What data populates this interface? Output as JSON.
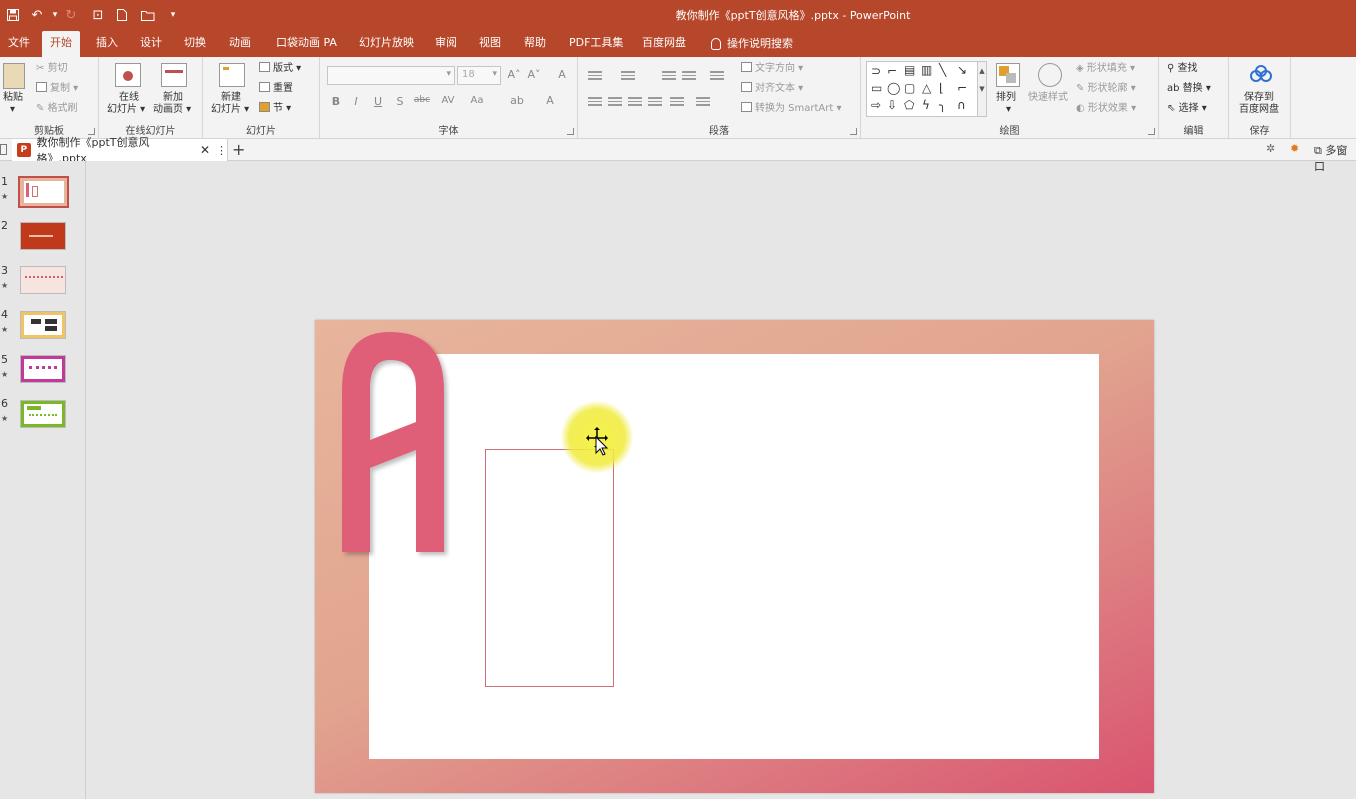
{
  "window": {
    "title": "教你制作《pptT创意风格》.pptx  -  PowerPoint",
    "accent": "#b7472a"
  },
  "quick_access": [
    {
      "name": "save-icon",
      "glyph": "💾"
    },
    {
      "name": "undo-icon",
      "glyph": "↶"
    },
    {
      "name": "redo-icon",
      "glyph": "↻"
    },
    {
      "name": "start-from-beginning-icon",
      "glyph": "⊡"
    },
    {
      "name": "new-file-icon",
      "glyph": "🗋"
    },
    {
      "name": "open-folder-icon",
      "glyph": "📂"
    },
    {
      "name": "customize-qat-icon",
      "glyph": "▾"
    }
  ],
  "tabs": [
    "文件",
    "开始",
    "插入",
    "设计",
    "切换",
    "动画",
    "口袋动画 PA",
    "幻灯片放映",
    "审阅",
    "视图",
    "帮助",
    "PDF工具集",
    "百度网盘"
  ],
  "tell_me": "操作说明搜索",
  "ribbon": {
    "clipboard": {
      "paste": "粘贴",
      "cut": "剪切",
      "copy": "复制",
      "format_painter": "格式刷",
      "label": "剪贴板"
    },
    "online_slides": {
      "online": "在线",
      "online2": "幻灯片 ▾",
      "new_anim": "新加",
      "new_anim2": "动画页 ▾",
      "label": "在线幻灯片"
    },
    "slides": {
      "new": "新建",
      "new2": "幻灯片 ▾",
      "layout": "版式 ▾",
      "reset": "重置",
      "section": "节 ▾",
      "label": "幻灯片"
    },
    "font": {
      "size": "18",
      "label": "字体",
      "bold": "B",
      "italic": "I",
      "underline": "U",
      "shadow": "S",
      "strike": "abc",
      "spacing": "AV",
      "case": "Aa",
      "grow": "A˄",
      "shrink": "A˅",
      "clear": "A",
      "color": "A"
    },
    "paragraph": {
      "direction": "文字方向 ▾",
      "align": "对齐文本 ▾",
      "smartart": "转换为 SmartArt ▾",
      "label": "段落"
    },
    "drawing": {
      "arrange": "排列",
      "quick_styles": "快速样式",
      "fill": "形状填充 ▾",
      "outline": "形状轮廓 ▾",
      "effects": "形状效果 ▾",
      "label": "绘图"
    },
    "editing": {
      "find": "查找",
      "replace": "替换",
      "select": "选择 ▾",
      "label": "编辑"
    },
    "save": {
      "save1": "保存到",
      "save2": "百度网盘",
      "label": "保存"
    }
  },
  "doc_tab": {
    "name": "教你制作《pptT创意风格》.pptx",
    "close": "✕",
    "more": "⋮",
    "add": "+",
    "multi_window": "多窗口"
  },
  "thumbnails": [
    {
      "num": "1",
      "star": "★"
    },
    {
      "num": "2",
      "star": ""
    },
    {
      "num": "3",
      "star": "★"
    },
    {
      "num": "4",
      "star": "★"
    },
    {
      "num": "5",
      "star": "★"
    },
    {
      "num": "6",
      "star": "★"
    }
  ],
  "slide": {
    "letter_color": "#df5f78"
  }
}
